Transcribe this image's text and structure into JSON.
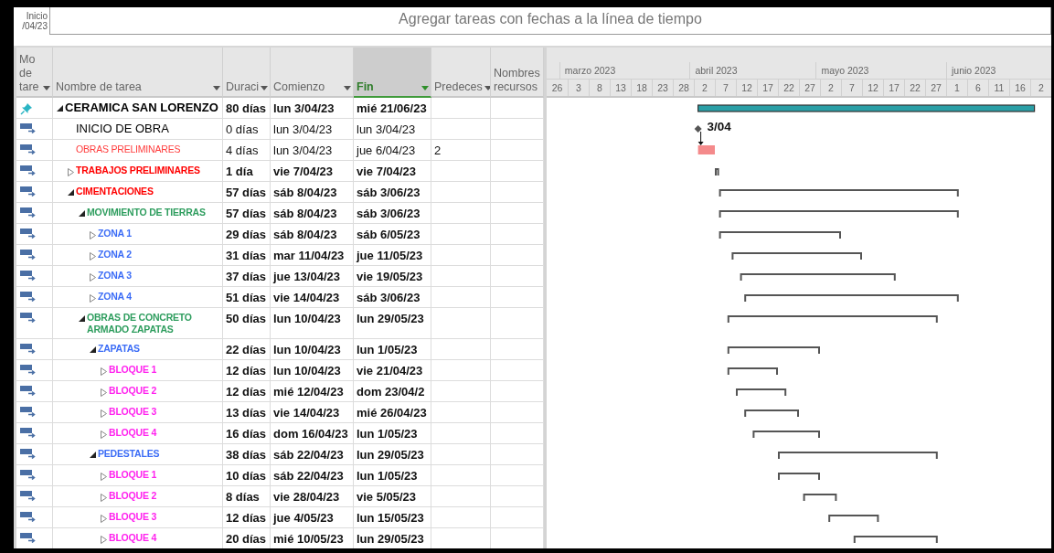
{
  "timeline": {
    "start_label": "Inicio",
    "start_date": "/04/23",
    "prompt": "Agregar tareas con fechas a la línea de tiempo"
  },
  "columns": [
    {
      "label": "Mo de tare",
      "filter": true,
      "selected": false
    },
    {
      "label": "Nombre de tarea",
      "filter": true,
      "selected": false
    },
    {
      "label": "Duraci",
      "filter": true,
      "selected": false
    },
    {
      "label": "Comienzo",
      "filter": true,
      "selected": false
    },
    {
      "label": "Fin",
      "filter": true,
      "selected": true
    },
    {
      "label": "Predeces",
      "filter": true,
      "selected": false
    },
    {
      "label": "Nombres recursos",
      "filter": false,
      "selected": false
    }
  ],
  "timescale": {
    "months": [
      "marzo 2023",
      "abril 2023",
      "mayo 2023",
      "junio 2023"
    ],
    "days": [
      "26",
      "3",
      "8",
      "13",
      "18",
      "23",
      "28",
      "2",
      "7",
      "12",
      "17",
      "22",
      "27",
      "2",
      "7",
      "12",
      "17",
      "22",
      "27",
      "1",
      "6",
      "11",
      "16",
      "2"
    ]
  },
  "tasks": [
    {
      "manual": true,
      "expanded": true,
      "name": "CERAMICA SAN LORENZO",
      "color": "#000000",
      "bold": true,
      "duration": "80 días",
      "start": "lun 3/04/23",
      "finish": "mié 21/06/23",
      "bar": {
        "kind": "project"
      },
      "children": [
        {
          "manual": false,
          "name": "INICIO DE OBRA",
          "color": "#000000",
          "bold": false,
          "duration": "0 días",
          "start": "lun 3/04/23",
          "finish": "lun 3/04/23",
          "bar": {
            "kind": "milestone",
            "label": "3/04"
          }
        },
        {
          "manual": false,
          "name": "OBRAS PRELIMINARES",
          "color": "#ff3b3b",
          "bold": false,
          "duration": "4 días",
          "start": "lun 3/04/23",
          "finish": "jue 6/04/23",
          "predecessors": "2",
          "bar": {
            "kind": "task"
          }
        },
        {
          "manual": false,
          "expanded": false,
          "name": "TRABAJOS PRELIMINARES",
          "color": "#ff0000",
          "bold": true,
          "duration": "1 día",
          "start": "vie 7/04/23",
          "finish": "vie 7/04/23",
          "bar": {
            "kind": "summary"
          }
        },
        {
          "manual": false,
          "expanded": true,
          "name": "CIMENTACIONES",
          "color": "#ff0000",
          "bold": true,
          "duration": "57 días",
          "start": "sáb 8/04/23",
          "finish": "sáb 3/06/23",
          "bar": {
            "kind": "summary"
          },
          "children": [
            {
              "manual": false,
              "expanded": true,
              "name": "MOVIMIENTO DE TIERRAS",
              "color": "#2e9d5e",
              "bold": true,
              "duration": "57 días",
              "start": "sáb 8/04/23",
              "finish": "sáb 3/06/23",
              "bar": {
                "kind": "summary"
              },
              "children": [
                {
                  "manual": false,
                  "expanded": false,
                  "name": "ZONA 1",
                  "color": "#3b6cf6",
                  "bold": true,
                  "duration": "29 días",
                  "start": "sáb 8/04/23",
                  "finish": "sáb 6/05/23",
                  "bar": {
                    "kind": "summary"
                  }
                },
                {
                  "manual": false,
                  "expanded": false,
                  "name": "ZONA 2",
                  "color": "#3b6cf6",
                  "bold": true,
                  "duration": "31 días",
                  "start": "mar 11/04/23",
                  "finish": "jue 11/05/23",
                  "bar": {
                    "kind": "summary"
                  }
                },
                {
                  "manual": false,
                  "expanded": false,
                  "name": "ZONA 3",
                  "color": "#3b6cf6",
                  "bold": true,
                  "duration": "37 días",
                  "start": "jue 13/04/23",
                  "finish": "vie 19/05/23",
                  "bar": {
                    "kind": "summary"
                  }
                },
                {
                  "manual": false,
                  "expanded": false,
                  "name": "ZONA 4",
                  "color": "#3b6cf6",
                  "bold": true,
                  "duration": "51 días",
                  "start": "vie 14/04/23",
                  "finish": "sáb 3/06/23",
                  "bar": {
                    "kind": "summary"
                  }
                }
              ]
            },
            {
              "manual": false,
              "expanded": true,
              "name": "OBRAS DE CONCRETO ARMADO ZAPATAS",
              "color": "#2e9d5e",
              "bold": true,
              "duration": "50 días",
              "start": "lun 10/04/23",
              "finish": "lun 29/05/23",
              "bar": {
                "kind": "summary"
              },
              "children": [
                {
                  "manual": false,
                  "expanded": true,
                  "name": "ZAPATAS",
                  "color": "#3b6cf6",
                  "bold": true,
                  "duration": "22 días",
                  "start": "lun 10/04/23",
                  "finish": "lun 1/05/23",
                  "bar": {
                    "kind": "summary"
                  },
                  "children": [
                    {
                      "manual": false,
                      "expanded": false,
                      "name": "BLOQUE 1",
                      "color": "#ff22ee",
                      "bold": true,
                      "duration": "12 días",
                      "start": "lun 10/04/23",
                      "finish": "vie 21/04/23",
                      "bar": {
                        "kind": "summary"
                      }
                    },
                    {
                      "manual": false,
                      "expanded": false,
                      "name": "BLOQUE 2",
                      "color": "#ff22ee",
                      "bold": true,
                      "duration": "12 días",
                      "start": "mié 12/04/23",
                      "finish": "dom 23/04/2",
                      "bar": {
                        "kind": "summary"
                      }
                    },
                    {
                      "manual": false,
                      "expanded": false,
                      "name": "BLOQUE 3",
                      "color": "#ff22ee",
                      "bold": true,
                      "duration": "13 días",
                      "start": "vie 14/04/23",
                      "finish": "mié 26/04/23",
                      "bar": {
                        "kind": "summary"
                      }
                    },
                    {
                      "manual": false,
                      "expanded": false,
                      "name": "BLOQUE 4",
                      "color": "#ff22ee",
                      "bold": true,
                      "duration": "16 días",
                      "start": "dom 16/04/23",
                      "finish": "lun 1/05/23",
                      "bar": {
                        "kind": "summary"
                      }
                    }
                  ]
                },
                {
                  "manual": false,
                  "expanded": true,
                  "name": "PEDESTALES",
                  "color": "#3b6cf6",
                  "bold": true,
                  "duration": "38 días",
                  "start": "sáb 22/04/23",
                  "finish": "lun 29/05/23",
                  "bar": {
                    "kind": "summary"
                  },
                  "children": [
                    {
                      "manual": false,
                      "expanded": false,
                      "name": "BLOQUE 1",
                      "color": "#ff22ee",
                      "bold": true,
                      "duration": "10 días",
                      "start": "sáb 22/04/23",
                      "finish": "lun 1/05/23",
                      "bar": {
                        "kind": "summary"
                      }
                    },
                    {
                      "manual": false,
                      "expanded": false,
                      "name": "BLOQUE 2",
                      "color": "#ff22ee",
                      "bold": true,
                      "duration": "8 días",
                      "start": "vie 28/04/23",
                      "finish": "vie 5/05/23",
                      "bar": {
                        "kind": "summary"
                      }
                    },
                    {
                      "manual": false,
                      "expanded": false,
                      "name": "BLOQUE 3",
                      "color": "#ff22ee",
                      "bold": true,
                      "duration": "12 días",
                      "start": "jue 4/05/23",
                      "finish": "lun 15/05/23",
                      "bar": {
                        "kind": "summary"
                      }
                    },
                    {
                      "manual": false,
                      "expanded": false,
                      "name": "BLOQUE 4",
                      "color": "#ff22ee",
                      "bold": true,
                      "duration": "20 días",
                      "start": "mié 10/05/23",
                      "finish": "lun 29/05/23",
                      "bar": {
                        "kind": "summary"
                      }
                    }
                  ]
                }
              ]
            }
          ]
        }
      ]
    }
  ]
}
